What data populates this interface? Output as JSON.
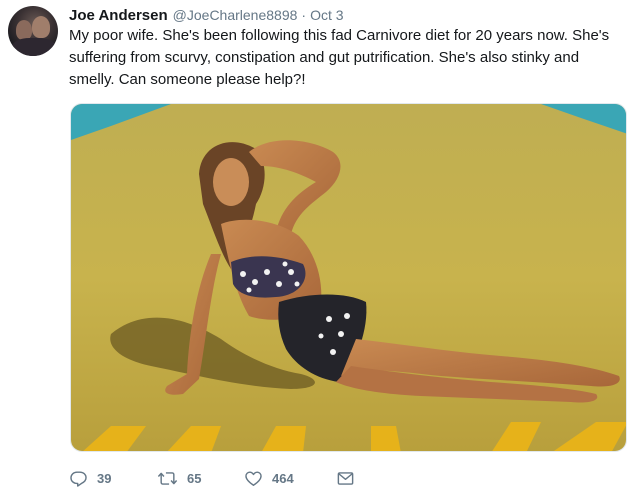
{
  "tweet": {
    "author_name": "Joe Andersen",
    "handle": "@JoeCharlene8898",
    "separator": "·",
    "date": "Oct 3",
    "text": "My poor wife. She's been following this fad Carnivore diet for 20 years now. She's suffering from scurvy, constipation and gut putrification. She's also stinky and smelly. Can someone please help?!"
  },
  "actions": {
    "reply_count": "39",
    "retweet_count": "65",
    "like_count": "464"
  },
  "icons": {
    "reply": "reply-icon",
    "retweet": "retweet-icon",
    "like": "heart-icon",
    "message": "envelope-icon"
  },
  "colors": {
    "text": "#14171a",
    "secondary": "#657786",
    "pavement": "#c9b24a",
    "water": "#3aa6b5"
  }
}
